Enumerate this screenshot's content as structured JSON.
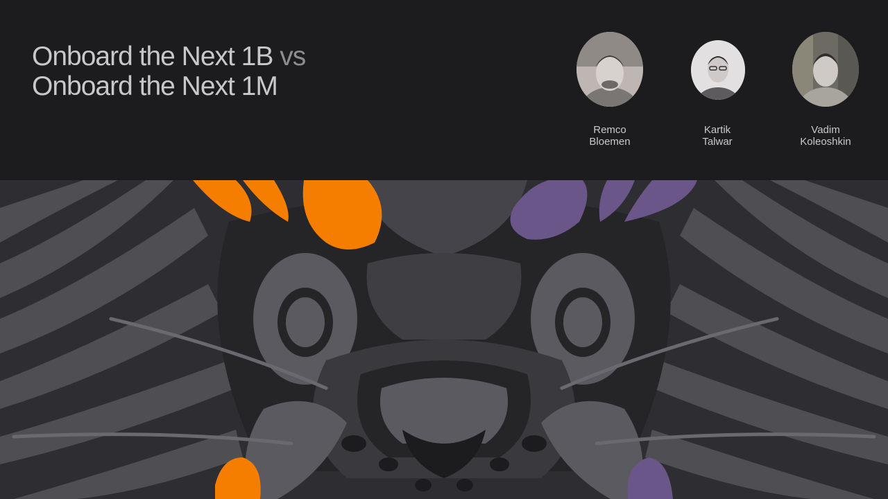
{
  "slide": {
    "title_line1_main": "Onboard the Next 1B",
    "title_line1_connector": "vs",
    "title_line2": "Onboard the Next 1M"
  },
  "speakers": [
    {
      "first": "Remco",
      "last": "Bloemen"
    },
    {
      "first": "Kartik",
      "last": "Talwar"
    },
    {
      "first": "Vadim",
      "last": "Koleoshkin"
    }
  ],
  "colors": {
    "background": "#1c1b1d",
    "accent_orange": "#f57d00",
    "accent_purple": "#6a5688",
    "artwork_gray": "#4f4e53"
  },
  "artwork": {
    "icon": "tiger-face-illustration"
  }
}
